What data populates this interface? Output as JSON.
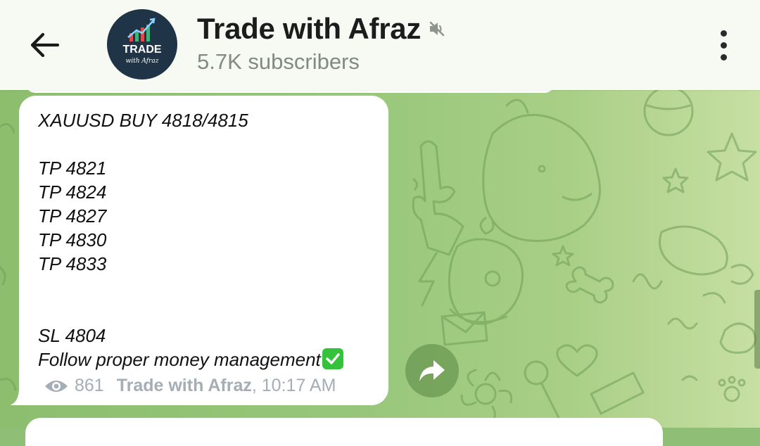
{
  "header": {
    "channel_name": "Trade with Afraz",
    "subscribers": "5.7K subscribers",
    "avatar_text_main": "TRADE",
    "avatar_text_sub": "with Afraz"
  },
  "message": {
    "lines": [
      "XAUUSD BUY 4818/4815",
      "",
      "TP 4821",
      "TP 4824",
      "TP 4827",
      "TP 4830",
      "TP 4833",
      "",
      "",
      "SL 4804",
      "Follow proper money management"
    ],
    "views": "861",
    "author": "Trade with Afraz",
    "time": ", 10:17 AM"
  },
  "icons": {
    "back": "arrow-left-icon",
    "mute": "muted-speaker-icon",
    "menu": "more-vertical-icon",
    "views": "eye-icon",
    "forward": "forward-arrow-icon",
    "check": "check-mark-emoji"
  },
  "colors": {
    "header_bg": "#f6faf3",
    "bubble_bg": "#ffffff",
    "chat_bg": "#8fbf77",
    "meta_text": "#a5adb5",
    "check_green": "#35c23b"
  }
}
